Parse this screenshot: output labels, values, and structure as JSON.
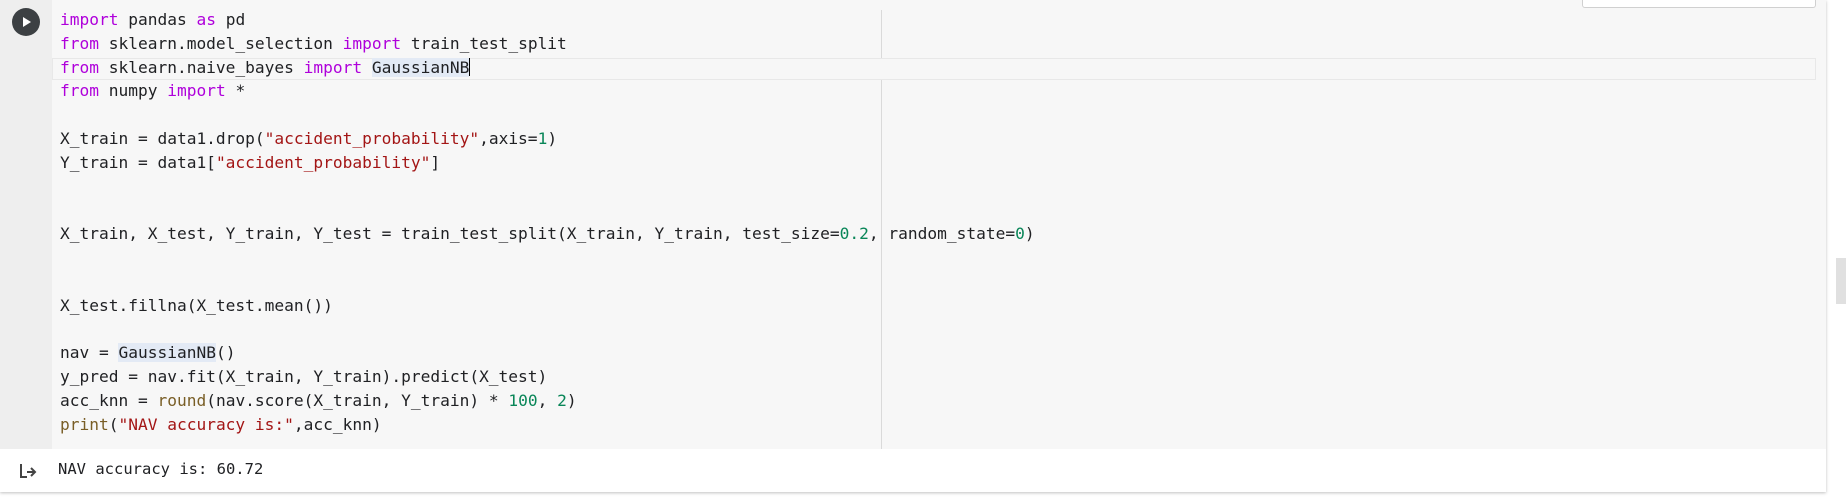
{
  "cell": {
    "code_lines": [
      "import pandas as pd",
      "from sklearn.model_selection import train_test_split",
      "from sklearn.naive_bayes import GaussianNB",
      "from numpy import *",
      "",
      "X_train = data1.drop(\"accident_probability\",axis=1)",
      "Y_train = data1[\"accident_probability\"]",
      "",
      "",
      "X_train, X_test, Y_train, Y_test = train_test_split(X_train, Y_train, test_size=0.2, random_state=0)",
      "",
      "",
      "X_test.fillna(X_test.mean())",
      "",
      "nav = GaussianNB()",
      "y_pred = nav.fit(X_train, Y_train).predict(X_test)",
      "acc_knn = round(nav.score(X_train, Y_train) * 100, 2)",
      "print(\"NAV accuracy is:\",acc_knn)"
    ],
    "output_text": "NAV accuracy is: 60.72",
    "icons": {
      "run": "play-icon",
      "output": "output-redirect-icon"
    }
  },
  "colors": {
    "keyword": "#af00db",
    "string": "#a31515",
    "number": "#098658",
    "builtin": "#795e26"
  }
}
